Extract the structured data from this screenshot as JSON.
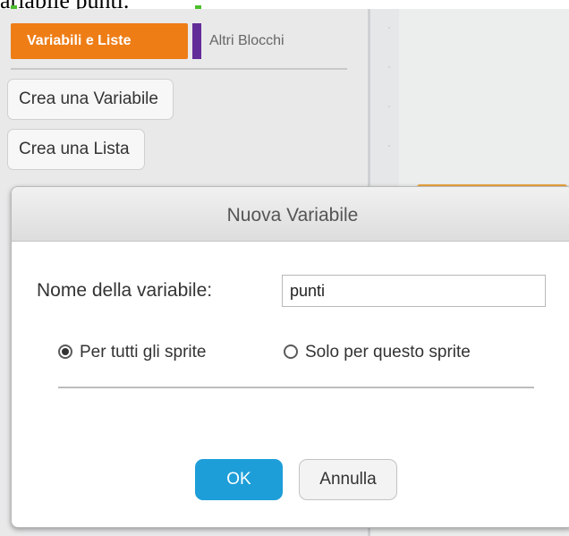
{
  "caption": "ariabile punti.",
  "palette": {
    "categories": [
      {
        "label": "Variabili e Liste",
        "active": true,
        "color": "#ee7d16"
      },
      {
        "label": "Altri Blocchi",
        "active": false,
        "color": "#632d99"
      }
    ],
    "buttons": {
      "make_variable": "Crea una Variabile",
      "make_list": "Crea una Lista"
    }
  },
  "dialog": {
    "title": "Nuova Variabile",
    "name_label": "Nome della variabile:",
    "name_value": "punti",
    "scope_options": [
      {
        "label": "Per tutti gli sprite",
        "selected": true
      },
      {
        "label": "Solo per questo sprite",
        "selected": false
      }
    ],
    "ok_label": "OK",
    "cancel_label": "Annulla"
  },
  "colors": {
    "accent": "#1d9ed8",
    "variables_category": "#ee7d16",
    "more_blocks_category": "#632d99"
  }
}
